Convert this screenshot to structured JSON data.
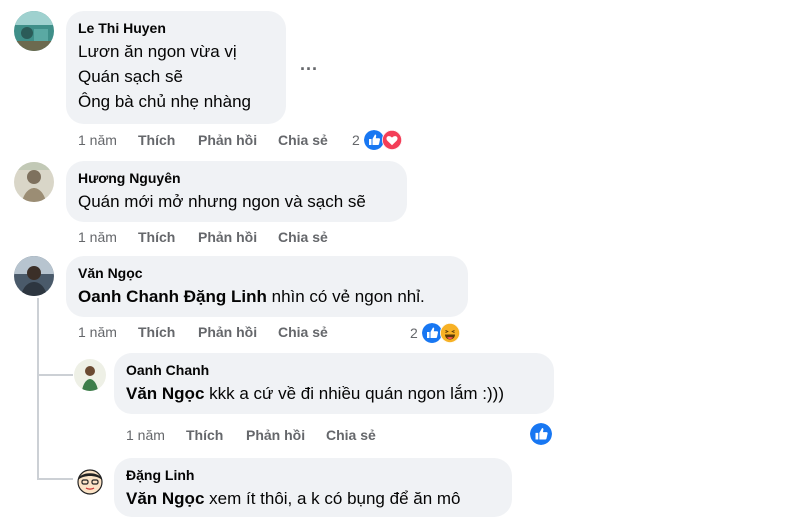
{
  "comments": [
    {
      "author": "Le Thi Huyen",
      "lines": [
        "Lươn ăn ngon vừa vị",
        "Quán sạch sẽ",
        "Ông bà chủ nhẹ nhàng"
      ],
      "time": "1 năm",
      "like": "Thích",
      "reply": "Phản hồi",
      "share": "Chia sẻ",
      "reaction_count": "2",
      "reactions": [
        "like-icon",
        "love-icon"
      ],
      "more_icon": "..."
    },
    {
      "author": "Hương Nguyên",
      "text": "Quán mới mở nhưng ngon và sạch sẽ",
      "time": "1 năm",
      "like": "Thích",
      "reply": "Phản hồi",
      "share": "Chia sẻ"
    },
    {
      "author": "Văn Ngọc",
      "mention": "Oanh Chanh Đặng Linh",
      "text": " nhìn có vẻ ngon nhỉ.",
      "time": "1 năm",
      "like": "Thích",
      "reply": "Phản hồi",
      "share": "Chia sẻ",
      "reaction_count": "2",
      "reactions": [
        "like-icon",
        "haha-icon"
      ],
      "replies": [
        {
          "author": "Oanh Chanh",
          "mention": "Văn Ngọc",
          "text": " kkk a cứ về đi nhiều quán ngon lắm :)))",
          "time": "1 năm",
          "like": "Thích",
          "reply": "Phản hồi",
          "share": "Chia sẻ",
          "reactions": [
            "like-icon"
          ]
        },
        {
          "author": "Đặng Linh",
          "mention": "Văn Ngọc",
          "text": " xem ít thôi, a k có bụng để ăn mô"
        }
      ]
    }
  ],
  "colors": {
    "bubble": "#f0f2f5",
    "meta": "#65676b",
    "like_blue": "#1877f2",
    "love_red": "#f33e58",
    "haha_yellow": "#f7b125"
  }
}
